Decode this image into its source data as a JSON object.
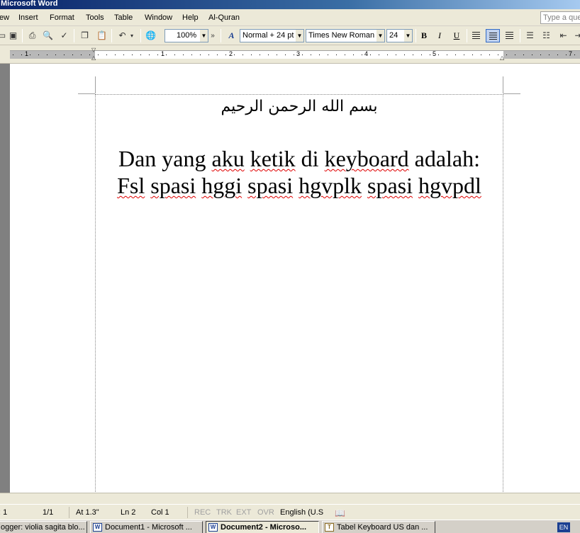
{
  "window": {
    "title": "Microsoft Word"
  },
  "menu": [
    "ew",
    "Insert",
    "Format",
    "Tools",
    "Table",
    "Window",
    "Help",
    "Al-Quran"
  ],
  "help_box": {
    "placeholder": "Type a que"
  },
  "toolbar": {
    "zoom": "100%",
    "style": "Normal + 24 pt",
    "font": "Times New Roman",
    "font_size": "24",
    "bold": "B",
    "italic": "I",
    "underline": "U"
  },
  "ruler": {
    "numbers": [
      "1",
      "1",
      "2",
      "3",
      "4",
      "5",
      "7"
    ]
  },
  "document": {
    "bismillah": "بسم الله الرحمن الرحيم",
    "line1_words": [
      "Dan",
      "yang",
      "aku",
      "ketik",
      "di",
      "keyboard",
      "adalah:"
    ],
    "line2_words": [
      "Fsl",
      "spasi",
      "hggi",
      "spasi",
      "hgvplk",
      "spasi",
      "hgvpdl"
    ]
  },
  "status": {
    "section": ": 1",
    "pages": "1/1",
    "at": "At  1.3\"",
    "ln": "Ln  2",
    "col": "Col  1",
    "rec": "REC",
    "trk": "TRK",
    "ext": "EXT",
    "ovr": "OVR",
    "language": "English (U.S"
  },
  "taskbar": {
    "tasks": [
      "ogger: violia sagita blo...",
      "Document1 - Microsoft ...",
      "Document2 - Microso...",
      "Tabel Keyboard US dan ..."
    ],
    "lang": "EN"
  },
  "colors": {
    "title_bar": "#0a246a",
    "spell_error": "#e00000",
    "chrome": "#ece9d8"
  }
}
